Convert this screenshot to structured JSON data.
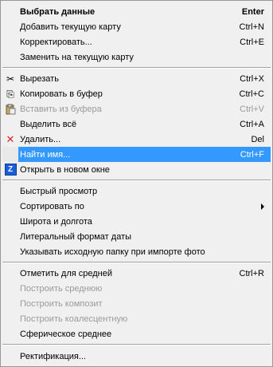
{
  "menu": {
    "items": [
      {
        "label": "Выбрать данные",
        "shortcut": "Enter"
      },
      {
        "label": "Добавить текущую карту",
        "shortcut": "Ctrl+N"
      },
      {
        "label": "Корректировать...",
        "shortcut": "Ctrl+E"
      },
      {
        "label": "Заменить на текущую карту",
        "shortcut": ""
      },
      {
        "label": "Вырезать",
        "shortcut": "Ctrl+X",
        "icon": "scissors-icon"
      },
      {
        "label": "Копировать в буфер",
        "shortcut": "Ctrl+C",
        "icon": "copy-icon"
      },
      {
        "label": "Вставить из буфера",
        "shortcut": "Ctrl+V",
        "icon": "paste-icon"
      },
      {
        "label": "Выделить всё",
        "shortcut": "Ctrl+A"
      },
      {
        "label": "Удалить...",
        "shortcut": "Del",
        "icon": "delete-x-icon"
      },
      {
        "label": "Найти имя...",
        "shortcut": "Ctrl+F"
      },
      {
        "label": "Открыть в новом окне",
        "shortcut": "",
        "icon": "z-app-icon"
      },
      {
        "label": "Быстрый просмотр",
        "shortcut": ""
      },
      {
        "label": "Сортировать по",
        "shortcut": ""
      },
      {
        "label": "Широта и долгота",
        "shortcut": ""
      },
      {
        "label": "Литеральный формат даты",
        "shortcut": ""
      },
      {
        "label": "Указывать исходную папку при импорте фото",
        "shortcut": ""
      },
      {
        "label": "Отметить для средней",
        "shortcut": "Ctrl+R"
      },
      {
        "label": "Построить среднюю",
        "shortcut": ""
      },
      {
        "label": "Построить композит",
        "shortcut": ""
      },
      {
        "label": "Построить коалесцентную",
        "shortcut": ""
      },
      {
        "label": "Сферическое среднее",
        "shortcut": ""
      },
      {
        "label": "Ректификация...",
        "shortcut": ""
      }
    ],
    "icon_glyphs": {
      "scissors": "✂",
      "copy": "⎘",
      "paste": "📋",
      "delete": "✕",
      "z": "Z"
    },
    "colors": {
      "highlight": "#3399ff",
      "disabled_text": "#9a9a9a",
      "delete_icon": "#d8242a",
      "z_icon": "#1a5fd8"
    }
  }
}
